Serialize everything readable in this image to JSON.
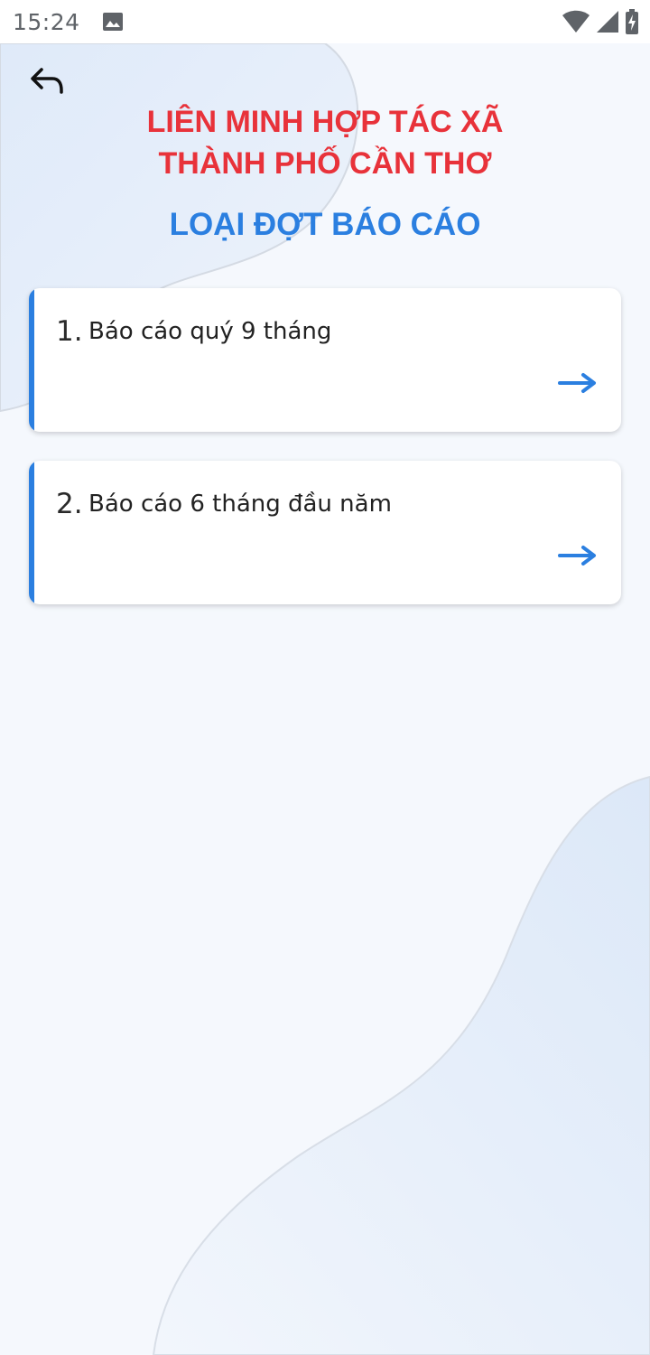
{
  "status_bar": {
    "time": "15:24",
    "icons": [
      "image-notification-icon",
      "wifi-icon",
      "cellular-signal-icon",
      "battery-charging-icon"
    ]
  },
  "header": {
    "back_icon": "back-arrow-icon",
    "org_line1": "LIÊN MINH HỢP TÁC XÃ",
    "org_line2": "THÀNH PHỐ CẦN THƠ",
    "section_title": "LOẠI ĐỢT BÁO CÁO"
  },
  "report_types": [
    {
      "number": "1.",
      "label": "Báo cáo quý 9 tháng",
      "icon": "arrow-right-icon"
    },
    {
      "number": "2.",
      "label": "Báo cáo 6 tháng đầu năm",
      "icon": "arrow-right-icon"
    }
  ],
  "colors": {
    "title_red": "#e8323a",
    "accent_blue": "#2b7fe0",
    "background": "#f5f8fd"
  }
}
